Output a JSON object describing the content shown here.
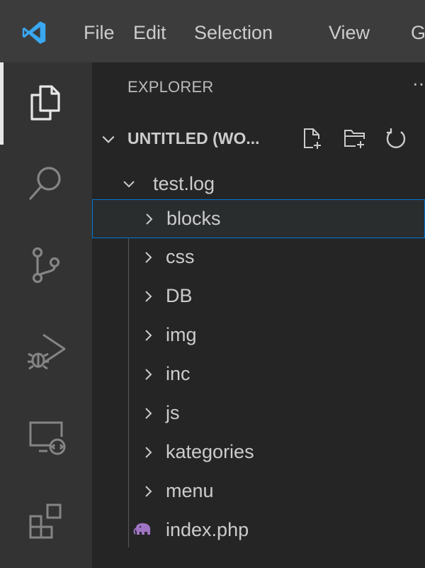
{
  "titlebar": {
    "app_icon": "vscode-logo-icon",
    "menu": [
      "File",
      "Edit",
      "Selection",
      "View",
      "G"
    ]
  },
  "activitybar": {
    "icons": [
      "explorer-icon",
      "search-icon",
      "source-control-icon",
      "run-debug-icon",
      "remote-explorer-icon",
      "extensions-icon"
    ]
  },
  "explorer": {
    "title": "EXPLORER",
    "more": "···",
    "workspace": {
      "title": "UNTITLED (WO...",
      "actions": [
        "new-file-icon",
        "new-folder-icon",
        "refresh-icon"
      ]
    },
    "root_folder": "test.log",
    "items": [
      {
        "label": "blocks",
        "type": "folder",
        "selected": true
      },
      {
        "label": "css",
        "type": "folder"
      },
      {
        "label": "DB",
        "type": "folder"
      },
      {
        "label": "img",
        "type": "folder"
      },
      {
        "label": "inc",
        "type": "folder"
      },
      {
        "label": "js",
        "type": "folder"
      },
      {
        "label": "kategories",
        "type": "folder"
      },
      {
        "label": "menu",
        "type": "folder"
      },
      {
        "label": "index.php",
        "type": "php-file"
      }
    ]
  },
  "colors": {
    "titlebar_bg": "#3c3c3c",
    "activitybar_bg": "#333333",
    "sidebar_bg": "#252526",
    "selection_border": "#0078d4",
    "text": "#cccccc",
    "vscode_blue": "#3aa7f2",
    "php_icon": "#a074c4"
  }
}
